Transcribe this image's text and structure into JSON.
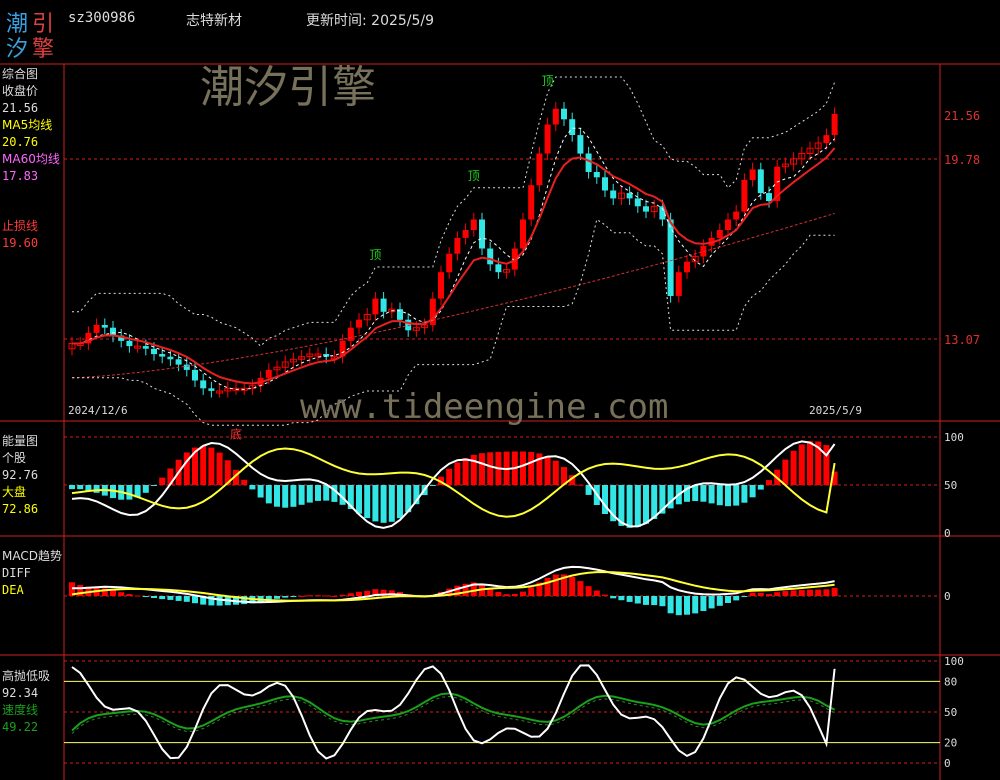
{
  "header": {
    "logo_chars": [
      "潮",
      "引",
      "汐",
      "擎"
    ],
    "code": "sz300986",
    "name": "志特新材",
    "updated": "更新时间: 2025/5/9"
  },
  "watermark": {
    "brand": "潮汐引擎",
    "url": "www.tideengine.com"
  },
  "colors": {
    "up": "#ff0000",
    "down": "#33e6e6",
    "ma5": "#ffff00",
    "ma60": "#e0303a",
    "stop": "#ff3b3b",
    "axis_red": "#d02020",
    "green": "#1aa01a"
  },
  "chart_data": [
    {
      "panel": "综合图",
      "type": "candlestick",
      "labels": {
        "title": "综合图",
        "close_label": "收盘价",
        "close_value": "21.56",
        "ma5_label": "MA5均线",
        "ma5_value": "20.76",
        "ma60_label": "MA60均线",
        "ma60_value": "17.83",
        "stop_label": "止损线",
        "stop_value": "19.60"
      },
      "x_start": "2024/12/6",
      "x_end": "2025/5/9",
      "y_ticks": [
        "21.56",
        "19.78",
        "13.07"
      ],
      "marks": [
        {
          "text": "顶",
          "bar": 37
        },
        {
          "text": "顶",
          "bar": 49
        },
        {
          "text": "顶",
          "bar": 58
        },
        {
          "text": "底",
          "bar": 20
        }
      ],
      "closes": [
        12.9,
        12.9,
        13.3,
        13.6,
        13.5,
        13.2,
        13.0,
        12.8,
        12.8,
        12.7,
        12.5,
        12.4,
        12.3,
        12.1,
        11.9,
        11.5,
        11.2,
        11.1,
        11.1,
        11.2,
        11.2,
        11.2,
        11.3,
        11.6,
        11.9,
        12.0,
        12.2,
        12.3,
        12.4,
        12.5,
        12.5,
        12.4,
        12.4,
        13.0,
        13.5,
        13.8,
        14.0,
        14.6,
        14.1,
        14.2,
        13.8,
        13.4,
        13.5,
        13.6,
        14.6,
        15.6,
        16.3,
        16.9,
        17.2,
        17.6,
        16.5,
        15.9,
        15.6,
        15.7,
        16.5,
        17.6,
        18.9,
        20.1,
        21.2,
        21.8,
        21.4,
        20.8,
        20.1,
        19.4,
        19.2,
        18.7,
        18.4,
        18.6,
        18.4,
        18.1,
        17.9,
        18.1,
        17.6,
        14.7,
        15.6,
        16.0,
        16.2,
        16.6,
        16.9,
        17.2,
        17.6,
        17.9,
        19.1,
        19.5,
        18.6,
        18.3,
        19.6,
        19.7,
        19.9,
        20.1,
        20.3,
        20.5,
        20.8,
        21.6
      ],
      "ma60_range": [
        11.6,
        17.83
      ]
    },
    {
      "panel": "能量图",
      "type": "line+bar",
      "labels": {
        "title": "能量图",
        "a_label": "个股",
        "a_value": "92.76",
        "b_label": "大盘",
        "b_value": "72.86"
      },
      "y_ticks": [
        "100",
        "50",
        "0"
      ]
    },
    {
      "panel": "MACD趋势",
      "type": "line+bar",
      "labels": {
        "title": "MACD趋势",
        "diff_label": "DIFF",
        "dea_label": "DEA"
      },
      "y_ticks": [
        "0"
      ]
    },
    {
      "panel": "高抛低吸",
      "type": "line",
      "labels": {
        "title": "高抛低吸",
        "a_value": "92.34",
        "b_label": "速度线",
        "b_value": "49.22"
      },
      "y_ticks": [
        "100",
        "80",
        "50",
        "20",
        "0"
      ]
    }
  ]
}
